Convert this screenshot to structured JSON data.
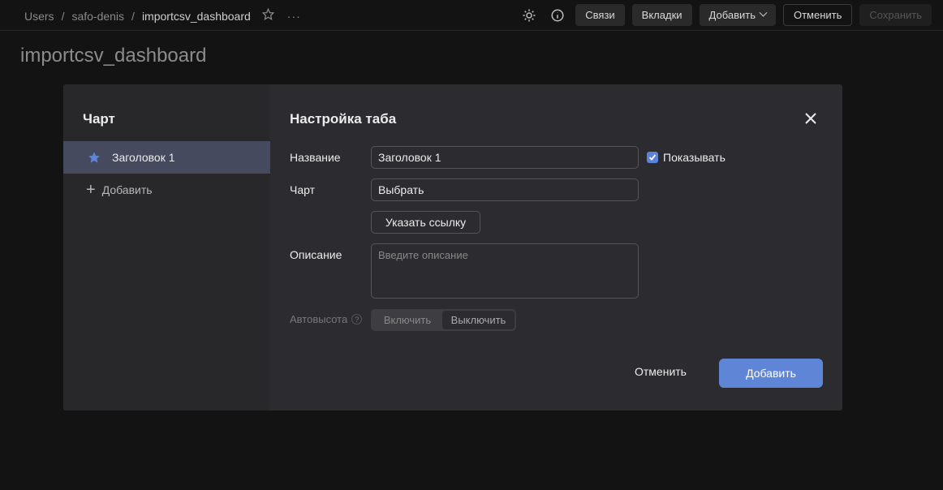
{
  "breadcrumbs": [
    "Users",
    "safo-denis",
    "importcsv_dashboard"
  ],
  "header": {
    "more_label": "···",
    "buttons": {
      "links": "Связи",
      "tabs": "Вкладки",
      "add": "Добавить",
      "cancel": "Отменить",
      "save": "Сохранить"
    }
  },
  "page": {
    "title": "importcsv_dashboard"
  },
  "modal": {
    "sidebar": {
      "title": "Чарт",
      "items": [
        {
          "label": "Заголовок 1",
          "selected": true
        }
      ],
      "add_label": "Добавить"
    },
    "main": {
      "title": "Настройка таба",
      "name_label": "Название",
      "name_value": "Заголовок 1",
      "show_label": "Показывать",
      "show_checked": true,
      "chart_label": "Чарт",
      "chart_value": "Выбрать",
      "link_button": "Указать ссылку",
      "description_label": "Описание",
      "description_placeholder": "Введите описание",
      "autoheight_label": "Автовысота",
      "autoheight_help": "?",
      "autoheight_options": [
        "Включить",
        "Выключить"
      ],
      "autoheight_selected": "Выключить",
      "cancel_button": "Отменить",
      "add_button": "Добавить"
    }
  },
  "colors": {
    "accent": "#5f86d6",
    "selected_item_bg": "#454a5f",
    "background": "#131313",
    "modal_bg": "#2c2c30"
  }
}
